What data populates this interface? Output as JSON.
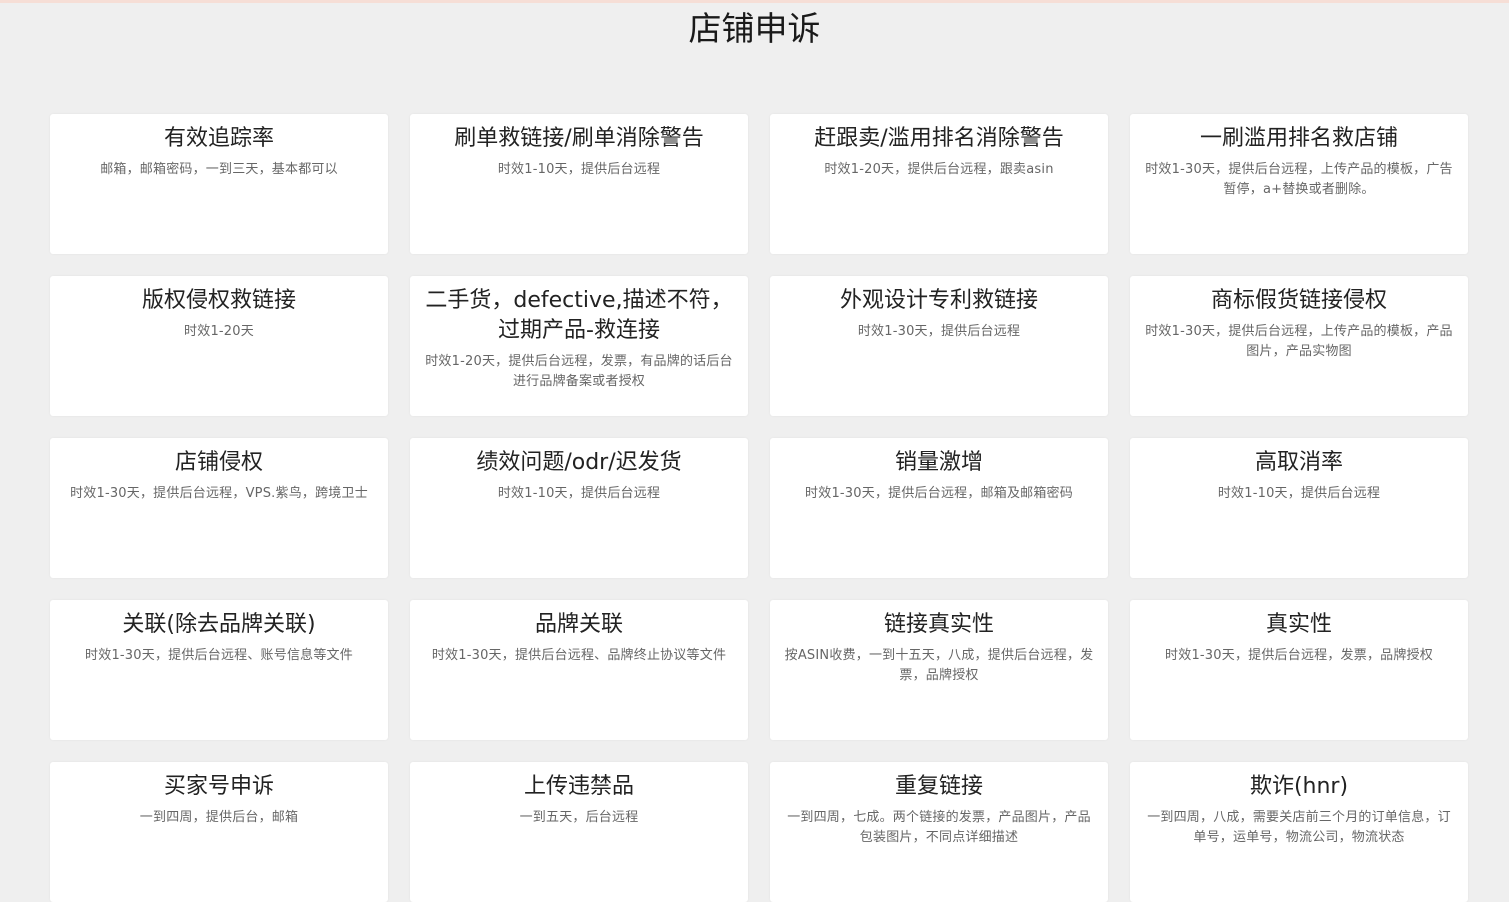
{
  "page": {
    "title": "店铺申诉"
  },
  "cards": [
    {
      "title": "有效追踪率",
      "desc": "邮箱，邮箱密码，一到三天，基本都可以"
    },
    {
      "title": "刷单救链接/刷单消除警告",
      "desc": "时效1-10天，提供后台远程"
    },
    {
      "title": "赶跟卖/滥用排名消除警告",
      "desc": "时效1-20天，提供后台远程，跟卖asin"
    },
    {
      "title": "一刷滥用排名救店铺",
      "desc": "时效1-30天，提供后台远程，上传产品的模板，广告暂停，a+替换或者删除。"
    },
    {
      "title": "版权侵权救链接",
      "desc": "时效1-20天"
    },
    {
      "title": "二手货，defective,描述不符，过期产品-救连接",
      "desc": "时效1-20天，提供后台远程，发票，有品牌的话后台进行品牌备案或者授权"
    },
    {
      "title": "外观设计专利救链接",
      "desc": "时效1-30天，提供后台远程"
    },
    {
      "title": "商标假货链接侵权",
      "desc": "时效1-30天，提供后台远程，上传产品的模板，产品图片，产品实物图"
    },
    {
      "title": "店铺侵权",
      "desc": "时效1-30天，提供后台远程，VPS.紫鸟，跨境卫士"
    },
    {
      "title": "绩效问题/odr/迟发货",
      "desc": "时效1-10天，提供后台远程"
    },
    {
      "title": "销量激增",
      "desc": "时效1-30天，提供后台远程，邮箱及邮箱密码"
    },
    {
      "title": "高取消率",
      "desc": "时效1-10天，提供后台远程"
    },
    {
      "title": "关联(除去品牌关联)",
      "desc": "时效1-30天，提供后台远程、账号信息等文件"
    },
    {
      "title": "品牌关联",
      "desc": "时效1-30天，提供后台远程、品牌终止协议等文件"
    },
    {
      "title": "链接真实性",
      "desc": "按ASIN收费，一到十五天，八成，提供后台远程，发票，品牌授权"
    },
    {
      "title": "真实性",
      "desc": "时效1-30天，提供后台远程，发票，品牌授权"
    },
    {
      "title": "买家号申诉",
      "desc": "一到四周，提供后台，邮箱"
    },
    {
      "title": "上传违禁品",
      "desc": "一到五天，后台远程"
    },
    {
      "title": "重复链接",
      "desc": "一到四周，七成。两个链接的发票，产品图片，产品包装图片，不同点详细描述"
    },
    {
      "title": "欺诈(hnr)",
      "desc": "一到四周，八成，需要关店前三个月的订单信息，订单号，运单号，物流公司，物流状态"
    }
  ],
  "colors": {
    "page_background": "#efefef",
    "card_background": "#ffffff",
    "title_text": "#222222",
    "desc_text": "#666666",
    "top_strip": "#f6ded6"
  }
}
